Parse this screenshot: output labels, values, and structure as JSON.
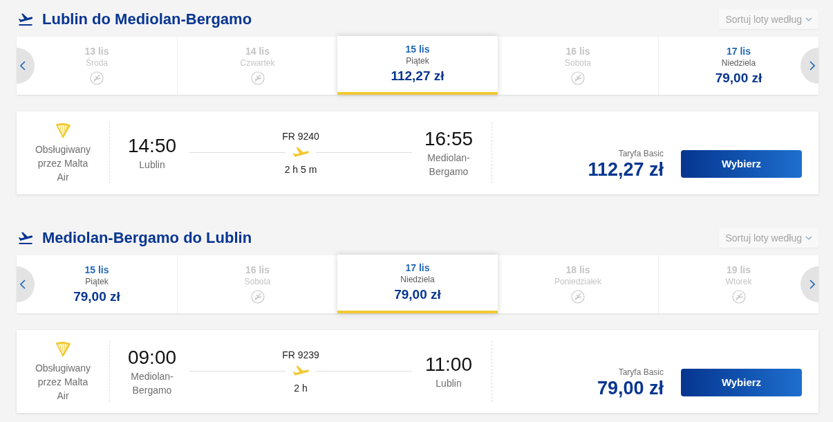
{
  "sections": [
    {
      "title": "Lublin do Mediolan-Bergamo",
      "sort_label": "Sortuj loty według",
      "dates": [
        {
          "date": "13 lis",
          "day": "Środa",
          "available": false,
          "selected": false
        },
        {
          "date": "14 lis",
          "day": "Czwartek",
          "available": false,
          "selected": false
        },
        {
          "date": "15 lis",
          "day": "Piątek",
          "available": true,
          "price": "112,27 zł",
          "selected": true
        },
        {
          "date": "16 lis",
          "day": "Sobota",
          "available": false,
          "selected": false
        },
        {
          "date": "17 lis",
          "day": "Niedziela",
          "available": true,
          "price": "79,00 zł",
          "selected": false
        }
      ],
      "flight": {
        "operator": "Obsługiwany przez Malta Air",
        "departure_time": "14:50",
        "departure_airport": "Lublin",
        "flight_number": "FR 9240",
        "duration": "2 h 5 m",
        "arrival_time": "16:55",
        "arrival_airport": "Mediolan-Bergamo",
        "fare": "Taryfa Basic",
        "price": "112,27 zł",
        "button": "Wybierz"
      }
    },
    {
      "title": "Mediolan-Bergamo do Lublin",
      "sort_label": "Sortuj loty według",
      "dates": [
        {
          "date": "15 lis",
          "day": "Piątek",
          "available": true,
          "price": "79,00 zł",
          "selected": false
        },
        {
          "date": "16 lis",
          "day": "Sobota",
          "available": false,
          "selected": false
        },
        {
          "date": "17 lis",
          "day": "Niedziela",
          "available": true,
          "price": "79,00 zł",
          "selected": true
        },
        {
          "date": "18 lis",
          "day": "Poniedziałek",
          "available": false,
          "selected": false
        },
        {
          "date": "19 lis",
          "day": "Wtorek",
          "available": false,
          "selected": false
        }
      ],
      "flight": {
        "operator": "Obsługiwany przez Malta Air",
        "departure_time": "09:00",
        "departure_airport": "Mediolan-Bergamo",
        "flight_number": "FR 9239",
        "duration": "2 h",
        "arrival_time": "11:00",
        "arrival_airport": "Lublin",
        "fare": "Taryfa Basic",
        "price": "79,00 zł",
        "button": "Wybierz"
      }
    }
  ]
}
